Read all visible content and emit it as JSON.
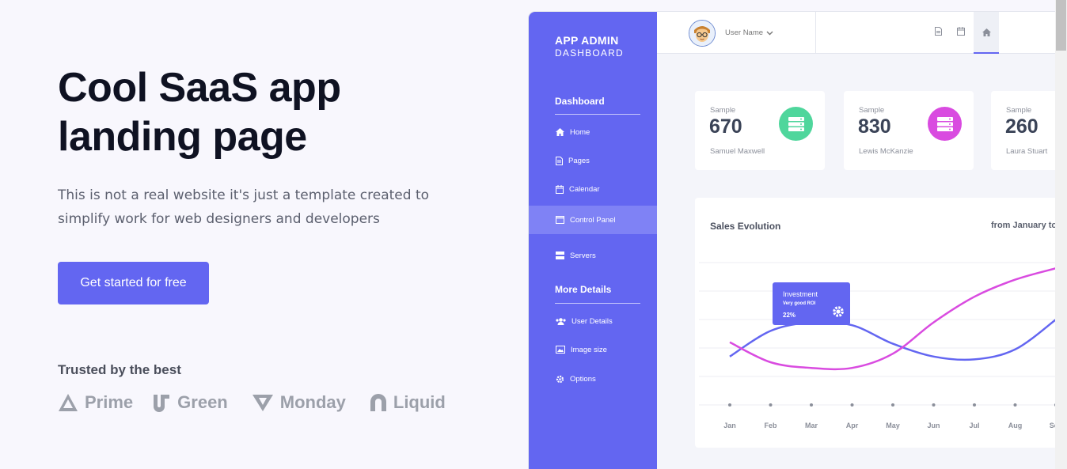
{
  "hero": {
    "title": "Cool SaaS app landing page",
    "subtitle": "This is not a real website it's just a template created to simplify work for web designers and developers",
    "cta": "Get started for free",
    "trusted": "Trusted by the best",
    "logos": [
      "Prime",
      "Green",
      "Monday",
      "Liquid"
    ]
  },
  "dashboard": {
    "brand_line1": "APP ADMIN",
    "brand_line2": "DASHBOARD",
    "section1": "Dashboard",
    "section2": "More Details",
    "nav": [
      "Home",
      "Pages",
      "Calendar",
      "Control Panel",
      "Servers"
    ],
    "nav2": [
      "User Details",
      "Image size",
      "Options"
    ],
    "active_nav": "Control Panel",
    "user_name": "User Name",
    "cards": [
      {
        "label": "Sample",
        "value": "670",
        "name": "Samuel Maxwell",
        "color": "#4fd69c"
      },
      {
        "label": "Sample",
        "value": "830",
        "name": "Lewis McKanzie",
        "color": "#d94be0"
      },
      {
        "label": "Sample",
        "value": "260",
        "name": "Laura Stuart",
        "color": "#6366f1"
      }
    ],
    "chart_title": "Sales Evolution",
    "chart_range": "from January to",
    "tooltip": {
      "title": "Investment",
      "subtitle": "Very good ROI",
      "value": "22%"
    }
  },
  "chart_data": {
    "type": "line",
    "x": [
      "Jan",
      "Feb",
      "Mar",
      "Apr",
      "May",
      "Jun",
      "Jul",
      "Aug",
      "Sep"
    ],
    "series": [
      {
        "values": [
          3.4,
          5.2,
          5.8,
          5.6,
          4.3,
          3.4,
          3.2,
          3.9,
          6.0
        ],
        "color": "#6366f1"
      },
      {
        "values": [
          4.4,
          3.0,
          2.6,
          2.6,
          3.6,
          5.8,
          7.6,
          8.8,
          9.6
        ],
        "color": "#d94be0"
      }
    ],
    "ylim": [
      0,
      10
    ],
    "grid": true
  }
}
